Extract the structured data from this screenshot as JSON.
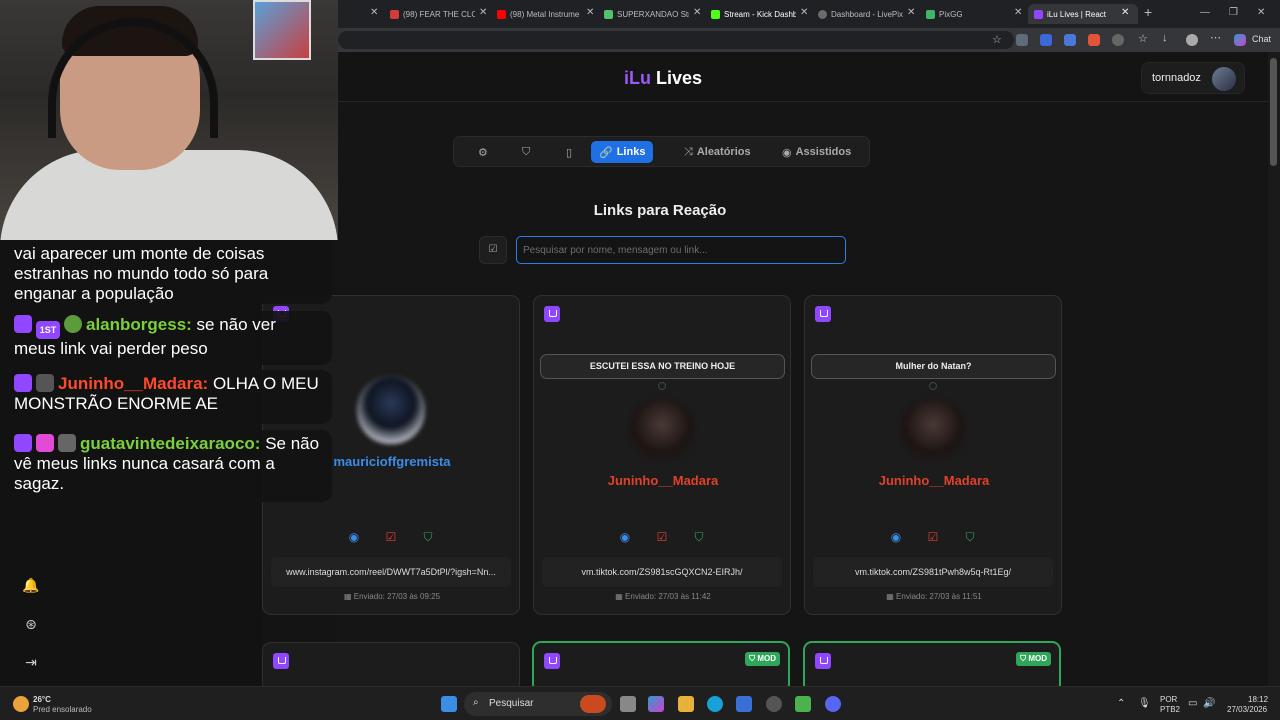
{
  "browser": {
    "tabs": [
      {
        "label": "(98) FEAR THE CLO",
        "color": "#d23b3b"
      },
      {
        "label": "(98) Metal Instrume",
        "color": "#ff0000"
      },
      {
        "label": "SUPERXANDAO Str",
        "color": "#53c26b"
      },
      {
        "label": "Stream - Kick Dashb",
        "color": "#53fc18"
      },
      {
        "label": "Dashboard - LivePix",
        "color": "#6b6b6b"
      },
      {
        "label": "PixGG",
        "color": "#3fb56a"
      },
      {
        "label": "iLu Lives | React",
        "color": "#9146ff"
      }
    ],
    "chat_label": "Chat"
  },
  "overlay_chat": [
    {
      "user": "",
      "user_color": "#ffffff",
      "text": "vai aparecer um monte de coisas estranhas no mundo todo só para enganar a população"
    },
    {
      "user": "alanborgess:",
      "user_color": "#7bd03a",
      "text": "se não ver meus link vai perder peso"
    },
    {
      "user": "Juninho__Madara:",
      "user_color": "#ff4a2a",
      "text": "OLHA O MEU MONSTRÃO ENORME AE"
    },
    {
      "user": "guatavintedeixaraoco:",
      "user_color": "#7bd03a",
      "text": "Se não vê meus links nunca casará com a sagaz."
    }
  ],
  "badges": {
    "first": "1ST"
  },
  "app": {
    "logo_i": "iLu",
    "logo_rest": "Lives",
    "username": "tornnadoz",
    "nav": {
      "links": "Links",
      "aleatorios": "Aleatórios",
      "assistidos": "Assistidos"
    },
    "page_title": "Links para Reação",
    "search_placeholder": "Pesquisar por nome, mensagem ou link..."
  },
  "cards": [
    {
      "message": "",
      "user": "mauricioffgremista",
      "user_color": "#3b8de8",
      "link": "www.instagram.com/reel/DWWT7a5DtPl/?igsh=Nn...",
      "sent": "Enviado: 27/03 às 09:25"
    },
    {
      "message": "ESCUTEI ESSA NO TREINO HOJE",
      "user": "Juninho__Madara",
      "user_color": "#e0412c",
      "link": "vm.tiktok.com/ZS981scGQXCN2-EIRJh/",
      "sent": "Enviado: 27/03 às 11:42"
    },
    {
      "message": "Mulher do Natan?",
      "user": "Juninho__Madara",
      "user_color": "#e0412c",
      "link": "vm.tiktok.com/ZS981tPwh8w5q-Rt1Eg/",
      "sent": "Enviado: 27/03 às 11:51"
    }
  ],
  "mod_label": "MOD",
  "taskbar": {
    "temp": "26°C",
    "weather": "Pred ensolarado",
    "search": "Pesquisar",
    "lang1": "POR",
    "lang2": "PTB2",
    "time": "18:12",
    "date": "27/03/2026"
  }
}
